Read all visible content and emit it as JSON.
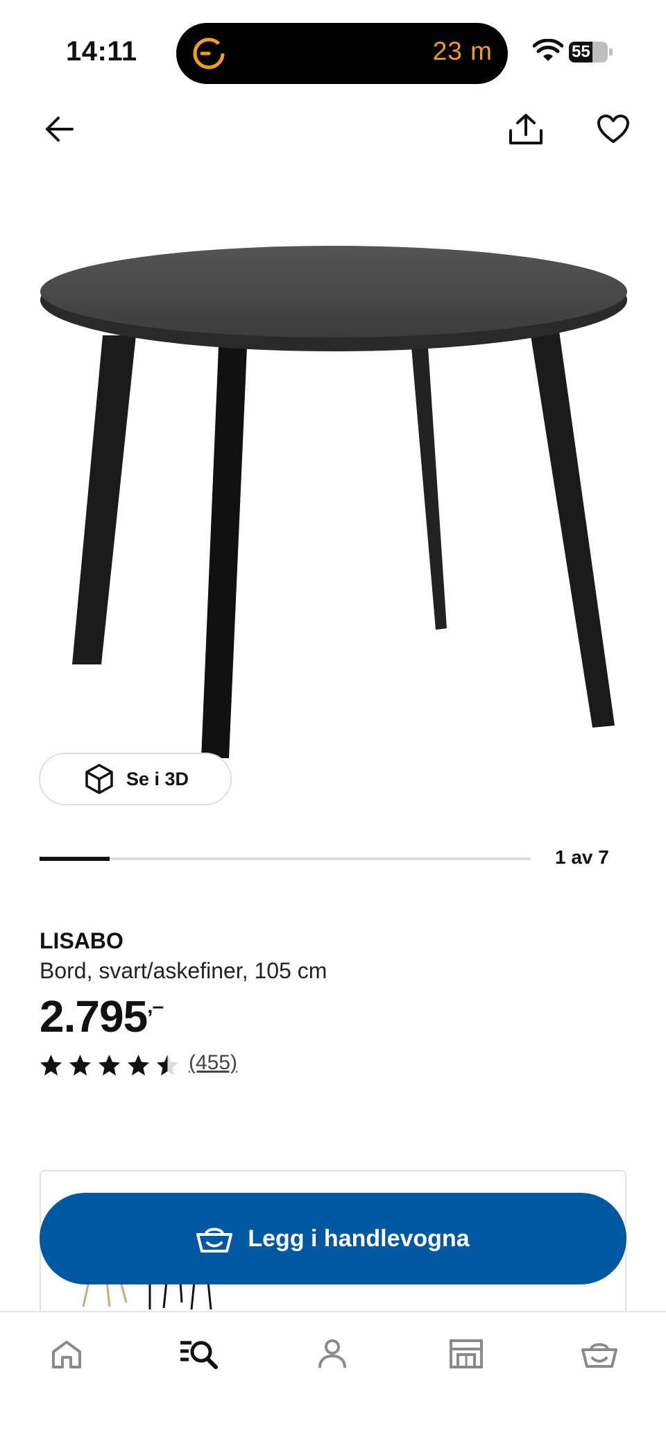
{
  "status_bar": {
    "time": "14:11",
    "activity_timer": "23 m",
    "battery_level": "55",
    "icons": [
      "timer-ring-icon",
      "wifi-icon",
      "battery-icon"
    ]
  },
  "top_nav": {
    "icons": [
      "back-arrow-icon",
      "share-icon",
      "heart-icon"
    ]
  },
  "gallery": {
    "view_3d_label": "Se i 3D",
    "counter": "1 av 7",
    "current": 1,
    "total": 7
  },
  "product": {
    "name": "LISABO",
    "description": "Bord, svart/askefiner, 105 cm",
    "price": "2.795",
    "price_suffix": ",–",
    "rating": 4.5,
    "rating_max": 5,
    "review_count": "(455)"
  },
  "cart_button": {
    "label": "Legg i handlevogna",
    "icon": "basket-icon",
    "color": "#0058a3"
  },
  "tab_bar": {
    "tabs": [
      {
        "name": "home",
        "icon": "home-icon"
      },
      {
        "name": "search",
        "icon": "search-list-icon"
      },
      {
        "name": "profile",
        "icon": "user-icon"
      },
      {
        "name": "store",
        "icon": "store-icon"
      },
      {
        "name": "cart",
        "icon": "basket-icon"
      }
    ]
  },
  "colors": {
    "accent_orange": "#f59a23",
    "ikea_blue": "#0058a3",
    "text": "#111111"
  }
}
